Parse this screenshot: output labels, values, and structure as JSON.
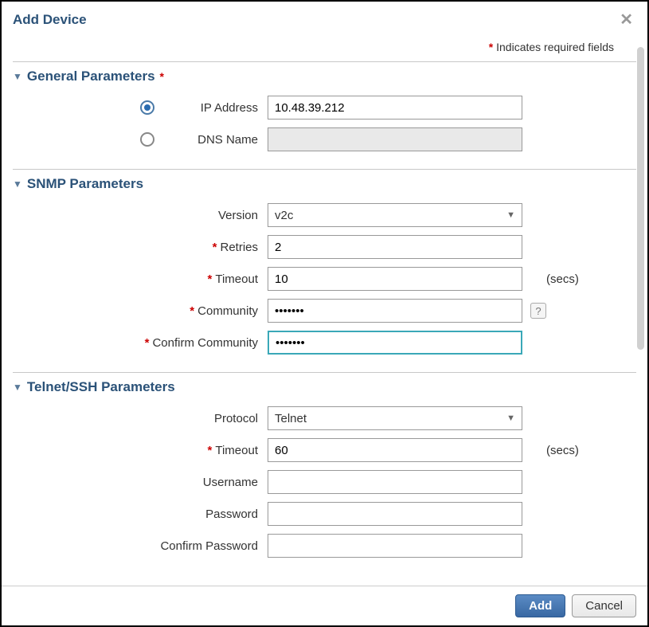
{
  "dialog": {
    "title": "Add Device",
    "requiredNote": "Indicates required fields"
  },
  "sections": {
    "general": {
      "title": "General Parameters",
      "required": true,
      "ipAddress": {
        "label": "IP Address",
        "value": "10.48.39.212",
        "selected": true
      },
      "dnsName": {
        "label": "DNS Name",
        "value": "",
        "selected": false
      }
    },
    "snmp": {
      "title": "SNMP Parameters",
      "version": {
        "label": "Version",
        "value": "v2c"
      },
      "retries": {
        "label": "Retries",
        "value": "2",
        "required": true
      },
      "timeout": {
        "label": "Timeout",
        "value": "10",
        "required": true,
        "suffix": "(secs)"
      },
      "community": {
        "label": "Community",
        "value": "•••••••",
        "required": true
      },
      "confirmCommunity": {
        "label": "Confirm Community",
        "value": "•••••••",
        "required": true
      }
    },
    "telnet": {
      "title": "Telnet/SSH Parameters",
      "protocol": {
        "label": "Protocol",
        "value": "Telnet"
      },
      "timeout": {
        "label": "Timeout",
        "value": "60",
        "required": true,
        "suffix": "(secs)"
      },
      "username": {
        "label": "Username",
        "value": ""
      },
      "password": {
        "label": "Password",
        "value": ""
      },
      "confirmPassword": {
        "label": "Confirm Password",
        "value": ""
      }
    }
  },
  "buttons": {
    "add": "Add",
    "cancel": "Cancel"
  }
}
